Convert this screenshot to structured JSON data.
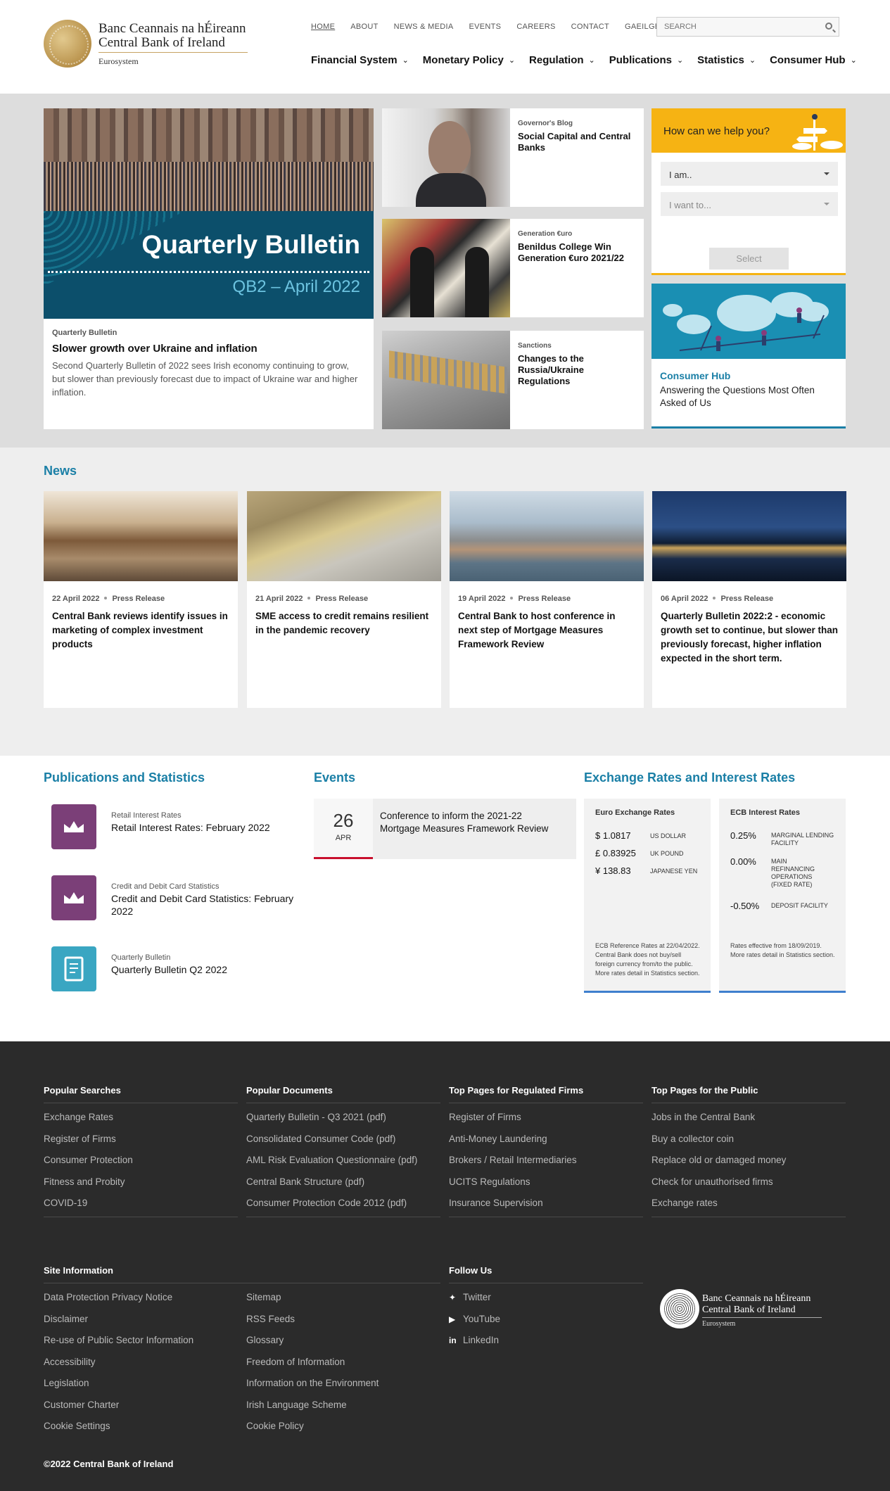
{
  "header": {
    "logo_irish": "Banc Ceannais na hÉireann",
    "logo_english": "Central Bank of Ireland",
    "logo_sub": "Eurosystem",
    "top_links": [
      "HOME",
      "ABOUT",
      "NEWS & MEDIA",
      "EVENTS",
      "CAREERS",
      "CONTACT",
      "GAEILGE"
    ],
    "search_placeholder": "SEARCH",
    "main_nav": [
      "Financial System",
      "Monetary Policy",
      "Regulation",
      "Publications",
      "Statistics",
      "Consumer Hub"
    ]
  },
  "hero": {
    "feature": {
      "image_title": "Quarterly Bulletin",
      "image_subtitle": "QB2 – April 2022",
      "category": "Quarterly Bulletin",
      "headline": "Slower growth over Ukraine and inflation",
      "description": "Second Quarterly Bulletin of 2022 sees Irish economy continuing to grow, but slower than previously forecast due to impact of Ukraine war and higher inflation."
    },
    "mid_cards": [
      {
        "category": "Governor's Blog",
        "headline": "Social Capital and Central Banks"
      },
      {
        "category": "Generation €uro",
        "headline": "Benildus College Win Generation €uro 2021/22"
      },
      {
        "category": "Sanctions",
        "headline": "Changes to the Russia/Ukraine Regulations"
      }
    ],
    "help": {
      "title": "How can we help you?",
      "select1": "I am..",
      "select2": "I want to...",
      "button": "Select"
    },
    "consumer_hub": {
      "category": "Consumer Hub",
      "headline": "Answering the Questions Most Often Asked of Us"
    }
  },
  "news": {
    "title": "News",
    "items": [
      {
        "date": "22 April 2022",
        "type": "Press Release",
        "headline": "Central Bank reviews identify issues in marketing of complex investment products"
      },
      {
        "date": "21 April 2022",
        "type": "Press Release",
        "headline": "SME access to credit remains resilient in the pandemic recovery"
      },
      {
        "date": "19 April 2022",
        "type": "Press Release",
        "headline": "Central Bank to host conference in next step of Mortgage Measures Framework Review"
      },
      {
        "date": "06 April 2022",
        "type": "Press Release",
        "headline": "Quarterly Bulletin 2022:2 - economic growth set to continue, but slower than previously forecast, higher inflation expected in the short term."
      }
    ]
  },
  "publications": {
    "title": "Publications and Statistics",
    "items": [
      {
        "category": "Retail Interest Rates",
        "headline": "Retail Interest Rates: February 2022",
        "color": "#7b3f78"
      },
      {
        "category": "Credit and Debit Card Statistics",
        "headline": "Credit and Debit Card Statistics: February 2022",
        "color": "#7b3f78"
      },
      {
        "category": "Quarterly Bulletin",
        "headline": "Quarterly Bulletin Q2 2022",
        "color": "#3aa6c2"
      }
    ]
  },
  "events": {
    "title": "Events",
    "items": [
      {
        "day": "26",
        "month": "APR",
        "title": "Conference to inform the 2021-22 Mortgage Measures Framework Review"
      }
    ]
  },
  "rates": {
    "title": "Exchange Rates and Interest Rates",
    "euro": {
      "title": "Euro Exchange Rates",
      "rows": [
        {
          "value": "$ 1.0817",
          "label": "US DOLLAR"
        },
        {
          "value": "£ 0.83925",
          "label": "UK POUND"
        },
        {
          "value": "¥ 138.83",
          "label": "JAPANESE YEN"
        }
      ],
      "note": "ECB Reference Rates at 22/04/2022. Central Bank does not buy/sell foreign currency from/to the public. More rates detail in Statistics section."
    },
    "ecb": {
      "title": "ECB Interest Rates",
      "rows": [
        {
          "value": "0.25%",
          "label": "MARGINAL LENDING FACILITY"
        },
        {
          "value": "0.00%",
          "label": "MAIN REFINANCING OPERATIONS (FIXED RATE)"
        },
        {
          "value": "-0.50%",
          "label": "DEPOSIT FACILITY"
        }
      ],
      "note": "Rates effective from 18/09/2019. More rates detail in Statistics section."
    }
  },
  "footer": {
    "columns": [
      {
        "title": "Popular Searches",
        "items": [
          "Exchange Rates",
          "Register of Firms",
          "Consumer Protection",
          "Fitness and Probity",
          "COVID-19"
        ]
      },
      {
        "title": "Popular Documents",
        "items": [
          "Quarterly Bulletin - Q3 2021 (pdf)",
          "Consolidated Consumer Code (pdf)",
          "AML Risk Evaluation Questionnaire (pdf)",
          "Central Bank Structure (pdf)",
          "Consumer Protection Code 2012 (pdf)"
        ]
      },
      {
        "title": "Top Pages for Regulated Firms",
        "items": [
          "Register of Firms",
          "Anti-Money Laundering",
          "Brokers / Retail Intermediaries",
          "UCITS Regulations",
          "Insurance Supervision"
        ]
      },
      {
        "title": "Top Pages for the Public",
        "items": [
          "Jobs in the Central Bank",
          "Buy a collector coin",
          "Replace old or damaged money",
          "Check for unauthorised firms",
          "Exchange rates"
        ]
      }
    ],
    "site_info": {
      "title": "Site Information",
      "col1": [
        "Data Protection Privacy Notice",
        "Disclaimer",
        "Re-use of Public Sector Information",
        "Accessibility",
        "Legislation",
        "Customer Charter",
        "Cookie Settings"
      ],
      "col2": [
        "Sitemap",
        "RSS Feeds",
        "Glossary",
        "Freedom of Information",
        "Information on the Environment",
        "Irish Language Scheme",
        "Cookie Policy"
      ]
    },
    "follow": {
      "title": "Follow Us",
      "items": [
        "Twitter",
        "YouTube",
        "LinkedIn"
      ]
    },
    "logo_irish": "Banc Ceannais na hÉireann",
    "logo_english": "Central Bank of Ireland",
    "logo_sub": "Eurosystem",
    "copyright": "©2022 Central Bank of Ireland"
  }
}
